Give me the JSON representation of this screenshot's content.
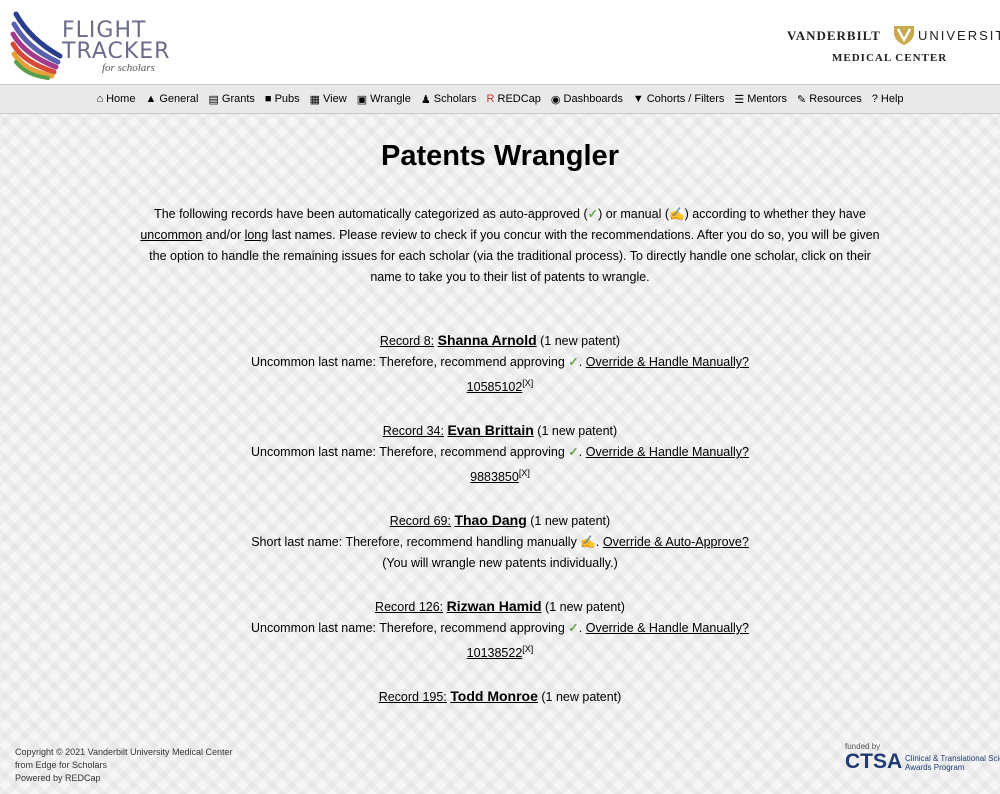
{
  "brand": {
    "logo_line1": "FLIGHT",
    "logo_line2": "TRACKER",
    "logo_line3": "for scholars"
  },
  "institution": {
    "name_left": "VANDERBILT",
    "name_right": "UNIVERSITY",
    "sub": "MEDICAL CENTER"
  },
  "nav": [
    {
      "icon": "home-icon",
      "glyph": "⌂",
      "label": "Home"
    },
    {
      "icon": "general-icon",
      "glyph": "▲",
      "label": "General"
    },
    {
      "icon": "grants-icon",
      "glyph": "▤",
      "label": "Grants"
    },
    {
      "icon": "pubs-icon",
      "glyph": "■",
      "label": "Pubs"
    },
    {
      "icon": "view-icon",
      "glyph": "▦",
      "label": "View"
    },
    {
      "icon": "wrangle-icon",
      "glyph": "▣",
      "label": "Wrangle"
    },
    {
      "icon": "scholars-icon",
      "glyph": "♟",
      "label": "Scholars"
    },
    {
      "icon": "redcap-icon",
      "glyph": "R",
      "label": "REDCap"
    },
    {
      "icon": "dashboards-icon",
      "glyph": "◉",
      "label": "Dashboards"
    },
    {
      "icon": "filter-icon",
      "glyph": "▼",
      "label": "Cohorts / Filters"
    },
    {
      "icon": "mentors-icon",
      "glyph": "☰",
      "label": "Mentors"
    },
    {
      "icon": "resources-icon",
      "glyph": "✎",
      "label": "Resources"
    },
    {
      "icon": "help-icon",
      "glyph": "?",
      "label": "Help"
    }
  ],
  "page": {
    "title": "Patents Wrangler",
    "intro_p1": "The following records have been automatically categorized as auto-approved (",
    "intro_p2": ") or manual (",
    "intro_p3": ") according to whether they have ",
    "intro_uncommon": "uncommon",
    "intro_p4": " and/or ",
    "intro_long": "long",
    "intro_p5": " last names. Please review to check if you concur with the recommendations. After you do so, you will be given the option to handle the remaining issues for each scholar (via the traditional process). To directly handle one scholar, click on their name to take you to their list of patents to wrangle.",
    "check_glyph": "✓",
    "hand_glyph": "✍"
  },
  "records": [
    {
      "record_label": "Record 8:",
      "name": "Shanna Arnold",
      "count": "(1 new patent)",
      "reason": "Uncommon last name: Therefore, recommend approving",
      "mark": "✓",
      "action": "Override & Handle Manually?",
      "patent": "10585102",
      "patent_x": "[X]",
      "note": ""
    },
    {
      "record_label": "Record 34:",
      "name": "Evan Brittain",
      "count": "(1 new patent)",
      "reason": "Uncommon last name: Therefore, recommend approving",
      "mark": "✓",
      "action": "Override & Handle Manually?",
      "patent": "9883850",
      "patent_x": "[X]",
      "note": ""
    },
    {
      "record_label": "Record 69:",
      "name": "Thao Dang",
      "count": "(1 new patent)",
      "reason": "Short last name: Therefore, recommend handling manually",
      "mark": "✍",
      "action": "Override & Auto-Approve?",
      "patent": "",
      "patent_x": "",
      "note": "(You will wrangle new patents individually.)"
    },
    {
      "record_label": "Record 126:",
      "name": "Rizwan Hamid",
      "count": "(1 new patent)",
      "reason": "Uncommon last name: Therefore, recommend approving",
      "mark": "✓",
      "action": "Override & Handle Manually?",
      "patent": "10138522",
      "patent_x": "[X]",
      "note": ""
    },
    {
      "record_label": "Record 195:",
      "name": "Todd Monroe",
      "count": "(1 new patent)",
      "reason": "",
      "mark": "",
      "action": "",
      "patent": "",
      "patent_x": "",
      "note": ""
    }
  ],
  "footer": {
    "copyright": "Copyright © 2021 Vanderbilt University Medical Center",
    "from": "from Edge for Scholars",
    "powered": "Powered by REDCap",
    "funded_by": "funded by",
    "ctsa": "CTSA",
    "ctsa_sub": "Clinical & Translational Science Awards Program"
  },
  "colors": {
    "check": "#6aa84f",
    "hand": "#e3a21a",
    "ctsa": "#1f3b72"
  }
}
